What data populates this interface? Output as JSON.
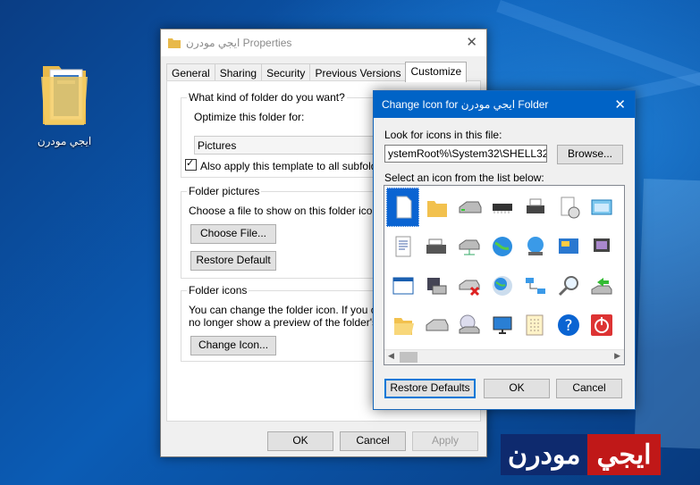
{
  "desktop": {
    "icon_label": "ايجي مودرن"
  },
  "properties_dialog": {
    "title": "ايجي مودرن Properties",
    "tabs": [
      "General",
      "Sharing",
      "Security",
      "Previous Versions",
      "Customize"
    ],
    "active_tab": "Customize",
    "folder_type_group": "What kind of folder do you want?",
    "optimize_label": "Optimize this folder for:",
    "optimize_value": "Pictures",
    "subfolders_checkbox": "Also apply this template to all subfolders",
    "folder_pictures_group": "Folder pictures",
    "choose_file_text": "Choose a file to show on this folder icon.",
    "choose_file_button": "Choose File...",
    "restore_default_button": "Restore Default",
    "folder_icons_group": "Folder icons",
    "folder_icons_text_1": "You can change the folder icon. If you chan",
    "folder_icons_text_2": "no longer show a preview of the folder's con",
    "change_icon_button": "Change Icon...",
    "ok_button": "OK",
    "cancel_button": "Cancel",
    "apply_button": "Apply"
  },
  "change_icon_dialog": {
    "title": "Change Icon for ايجي مودرن Folder",
    "look_label": "Look for icons in this file:",
    "path_value": "ystemRoot%\\System32\\SHELL32.dll",
    "browse_button": "Browse...",
    "select_label": "Select an icon from the list below:",
    "restore_defaults_button": "Restore Defaults",
    "ok_button": "OK",
    "cancel_button": "Cancel",
    "icons": [
      [
        "blank-document-icon",
        "folder-icon",
        "hard-drive-icon",
        "memory-chip-icon",
        "printer-icon",
        "document-clock-icon",
        "window-icon",
        "partial-icon"
      ],
      [
        "text-document-icon",
        "drive-bay-icon",
        "network-drive-icon",
        "globe-icon",
        "network-globe-icon",
        "control-panel-icon",
        "display-icon",
        "shortcut-arrow-icon"
      ],
      [
        "application-window-icon",
        "floppy-printer-icon",
        "drive-error-icon",
        "world-cd-icon",
        "network-icon",
        "search-magnifier-icon",
        "green-arrow-drive-icon",
        "partial-icon"
      ],
      [
        "open-folder-icon",
        "drive-icon",
        "cd-drive-icon",
        "monitor-icon",
        "calculator-grid-icon",
        "help-icon",
        "power-icon",
        "partial-icon"
      ]
    ]
  },
  "watermark": {
    "part1": "ايجي",
    "part2": "مودرن"
  }
}
